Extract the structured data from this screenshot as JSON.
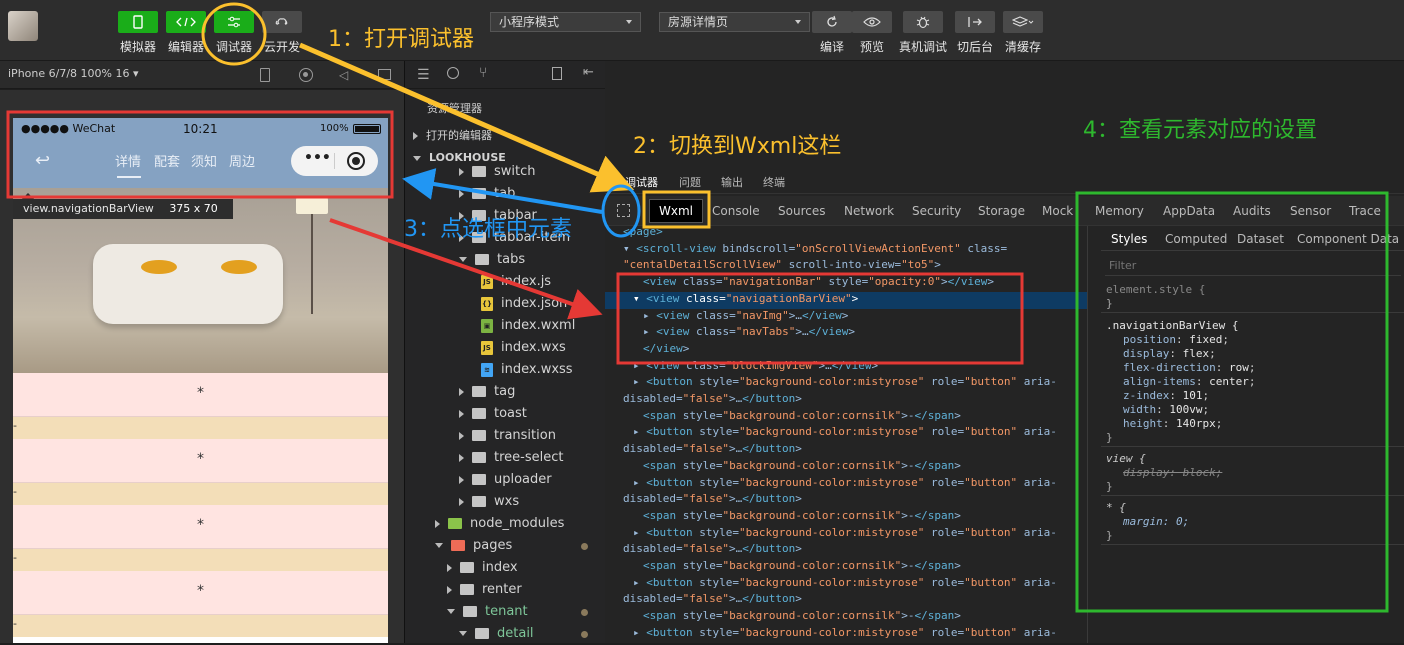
{
  "toolbar": {
    "buttons": [
      {
        "label": "模拟器",
        "icon": "phone-icon"
      },
      {
        "label": "编辑器",
        "icon": "code-icon"
      },
      {
        "label": "调试器",
        "icon": "sliders-icon"
      },
      {
        "label": "云开发",
        "icon": "cloud-icon"
      }
    ],
    "mode_select": "小程序模式",
    "page_select": "房源详情页",
    "right_buttons": [
      {
        "label": "编译",
        "icon": "refresh-icon"
      },
      {
        "label": "预览",
        "icon": "eye-icon"
      },
      {
        "label": "真机调试",
        "icon": "bug-icon"
      },
      {
        "label": "切后台",
        "icon": "switch-icon"
      },
      {
        "label": "清缓存",
        "icon": "layers-icon"
      }
    ]
  },
  "simulator": {
    "device": "iPhone 6/7/8 100% 16",
    "status": {
      "carrier": "●●●●● WeChat",
      "time": "10:21",
      "battery": "100%"
    },
    "nav_tabs": [
      "详情",
      "配套",
      "须知",
      "周边"
    ],
    "capsule_more": "•••",
    "tooltip_name": "view.navigationBarView",
    "tooltip_size": "375 x 70",
    "items": [
      "*",
      "-",
      "*",
      "-",
      "*",
      "-",
      "*",
      "-"
    ]
  },
  "explorer": {
    "title": "资源管理器",
    "open_editors": "打开的编辑器",
    "project": "LOOKHOUSE",
    "tree": [
      {
        "name": "switch",
        "type": "folder",
        "depth": 3
      },
      {
        "name": "tab",
        "type": "folder",
        "depth": 3
      },
      {
        "name": "tabbar",
        "type": "folder",
        "depth": 3
      },
      {
        "name": "tabbar-item",
        "type": "folder",
        "depth": 3
      },
      {
        "name": "tabs",
        "type": "folder-open",
        "depth": 3
      },
      {
        "name": "index.js",
        "type": "js",
        "depth": 4
      },
      {
        "name": "index.json",
        "type": "json",
        "depth": 4
      },
      {
        "name": "index.wxml",
        "type": "wxml",
        "depth": 4
      },
      {
        "name": "index.wxs",
        "type": "js",
        "depth": 4
      },
      {
        "name": "index.wxss",
        "type": "wxss",
        "depth": 4
      },
      {
        "name": "tag",
        "type": "folder",
        "depth": 3
      },
      {
        "name": "toast",
        "type": "folder",
        "depth": 3
      },
      {
        "name": "transition",
        "type": "folder",
        "depth": 3
      },
      {
        "name": "tree-select",
        "type": "folder",
        "depth": 3
      },
      {
        "name": "uploader",
        "type": "folder",
        "depth": 3
      },
      {
        "name": "wxs",
        "type": "folder",
        "depth": 3
      },
      {
        "name": "node_modules",
        "type": "folder-green",
        "depth": 1
      },
      {
        "name": "pages",
        "type": "folder-red-open",
        "depth": 1,
        "dot": true
      },
      {
        "name": "index",
        "type": "folder",
        "depth": 2
      },
      {
        "name": "renter",
        "type": "folder",
        "depth": 2
      },
      {
        "name": "tenant",
        "type": "folder-open",
        "depth": 2,
        "dot": true,
        "color": "#7ec699"
      },
      {
        "name": "detail",
        "type": "folder-open",
        "depth": 3,
        "dot": true,
        "color": "#7ec699"
      }
    ]
  },
  "devtools": {
    "top_tabs": [
      "调试器",
      "问题",
      "输出",
      "终端"
    ],
    "panel_tabs": [
      "Wxml",
      "Console",
      "Sources",
      "Network",
      "Security",
      "Storage",
      "Mock",
      "Memory",
      "AppData",
      "Audits",
      "Sensor",
      "Trace"
    ],
    "wxml_lines": [
      {
        "html": "&lt;page&gt;",
        "indent": 0
      },
      {
        "text": "▾ <scroll-view bindscroll=\"onScrollViewActionEvent\" class=",
        "indent": 0
      },
      {
        "text": "\"centalDetailScrollView\" scroll-into-view=\"to5\">",
        "indent": 0
      },
      {
        "text": "<view class=\"navigationBar\" style=\"opacity:0\"></view>",
        "indent": 2
      },
      {
        "text": "▾ <view class=\"navigationBarView\">",
        "indent": 1,
        "selected": true
      },
      {
        "text": "▸ <view class=\"navImg\">…</view>",
        "indent": 2
      },
      {
        "text": "▸ <view class=\"navTabs\">…</view>",
        "indent": 2
      },
      {
        "text": "</view>",
        "indent": 2
      },
      {
        "text": "▸ <view class=\"blockImgView\">…</view>",
        "indent": 1
      },
      {
        "text": "▸ <button style=\"background-color:mistyrose\" role=\"button\" aria-",
        "indent": 1
      },
      {
        "text": "disabled=\"false\">…</button>",
        "indent": 0
      },
      {
        "text": "<span style=\"background-color:cornsilk\">-</span>",
        "indent": 2
      },
      {
        "text": "▸ <button style=\"background-color:mistyrose\" role=\"button\" aria-",
        "indent": 1
      },
      {
        "text": "disabled=\"false\">…</button>",
        "indent": 0
      },
      {
        "text": "<span style=\"background-color:cornsilk\">-</span>",
        "indent": 2
      },
      {
        "text": "▸ <button style=\"background-color:mistyrose\" role=\"button\" aria-",
        "indent": 1
      },
      {
        "text": "disabled=\"false\">…</button>",
        "indent": 0
      },
      {
        "text": "<span style=\"background-color:cornsilk\">-</span>",
        "indent": 2
      },
      {
        "text": "▸ <button style=\"background-color:mistyrose\" role=\"button\" aria-",
        "indent": 1
      },
      {
        "text": "disabled=\"false\">…</button>",
        "indent": 0
      },
      {
        "text": "<span style=\"background-color:cornsilk\">-</span>",
        "indent": 2
      },
      {
        "text": "▸ <button style=\"background-color:mistyrose\" role=\"button\" aria-",
        "indent": 1
      },
      {
        "text": "disabled=\"false\">…</button>",
        "indent": 0
      },
      {
        "text": "<span style=\"background-color:cornsilk\">-</span>",
        "indent": 2
      },
      {
        "text": "▸ <button style=\"background-color:mistyrose\" role=\"button\" aria-",
        "indent": 1
      }
    ],
    "style_tabs": [
      "Styles",
      "Computed",
      "Dataset",
      "Component Data"
    ],
    "filter_placeholder": "Filter",
    "rules": {
      "element_style": "element.style {",
      "close": "}",
      "selector": ".navigationBarView {",
      "props": [
        {
          "name": "position",
          "value": "fixed"
        },
        {
          "name": "display",
          "value": "flex"
        },
        {
          "name": "flex-direction",
          "value": "row"
        },
        {
          "name": "align-items",
          "value": "center"
        },
        {
          "name": "z-index",
          "value": "101"
        },
        {
          "name": "width",
          "value": "100vw"
        },
        {
          "name": "height",
          "value": "140rpx"
        }
      ],
      "view_selector": "view {",
      "view_prop": "display: block;",
      "star_selector": "* {",
      "star_prop": "margin: 0;"
    }
  },
  "annotations": {
    "step1": "1：打开调试器",
    "step2": "2：切换到Wxml这栏",
    "step3": "3：点选框中元素",
    "step4": "4：查看元素对应的设置",
    "colors": {
      "yellow": "#fbc02d",
      "red": "#e53935",
      "blue": "#2196f3",
      "green": "#2eb82e"
    }
  }
}
